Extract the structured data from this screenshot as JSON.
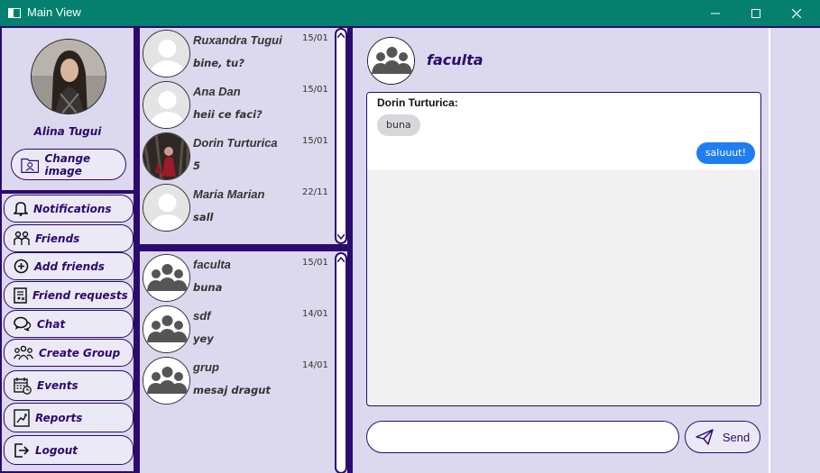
{
  "window": {
    "title": "Main View"
  },
  "profile": {
    "name": "Alina Tugui",
    "change_image_label": "Change image"
  },
  "menu": [
    {
      "label": "Notifications",
      "icon": "bell-icon"
    },
    {
      "label": "Friends",
      "icon": "friends-icon"
    },
    {
      "label": "Add friends",
      "icon": "add-circle-icon"
    },
    {
      "label": "Friend requests",
      "icon": "request-document-icon"
    },
    {
      "label": "Chat",
      "icon": "chat-bubbles-icon"
    },
    {
      "label": "Create Group",
      "icon": "group-icon"
    },
    {
      "label": "Events",
      "icon": "calendar-icon"
    },
    {
      "label": "Reports",
      "icon": "report-chart-icon"
    },
    {
      "label": "Logout",
      "icon": "logout-icon"
    }
  ],
  "chats": [
    {
      "name": "Ruxandra Tugui",
      "date": "15/01",
      "message": "bine, tu?",
      "avatar": "default-user"
    },
    {
      "name": "Ana Dan",
      "date": "15/01",
      "message": "heii ce faci?",
      "avatar": "default-user"
    },
    {
      "name": "Dorin Turturica",
      "date": "15/01",
      "message": "5",
      "avatar": "photo"
    },
    {
      "name": "Maria Marian",
      "date": "22/11",
      "message": "sall",
      "avatar": "default-user"
    }
  ],
  "groups": [
    {
      "name": "faculta",
      "date": "15/01",
      "message": "buna"
    },
    {
      "name": "sdf",
      "date": "14/01",
      "message": "yey"
    },
    {
      "name": "grup",
      "date": "14/01",
      "message": "mesaj dragut"
    }
  ],
  "conversation": {
    "title": "faculta",
    "messages": [
      {
        "sender": "Dorin Turturica:",
        "text": "buna",
        "direction": "incoming"
      },
      {
        "text": "saluuut!",
        "direction": "outgoing"
      }
    ],
    "input_value": "",
    "send_label": "Send"
  },
  "colors": {
    "accent": "#2a0a6e",
    "titlebar": "#05806e",
    "panel": "#dcd8ee",
    "outgoing_bubble": "#1e7ef0"
  }
}
